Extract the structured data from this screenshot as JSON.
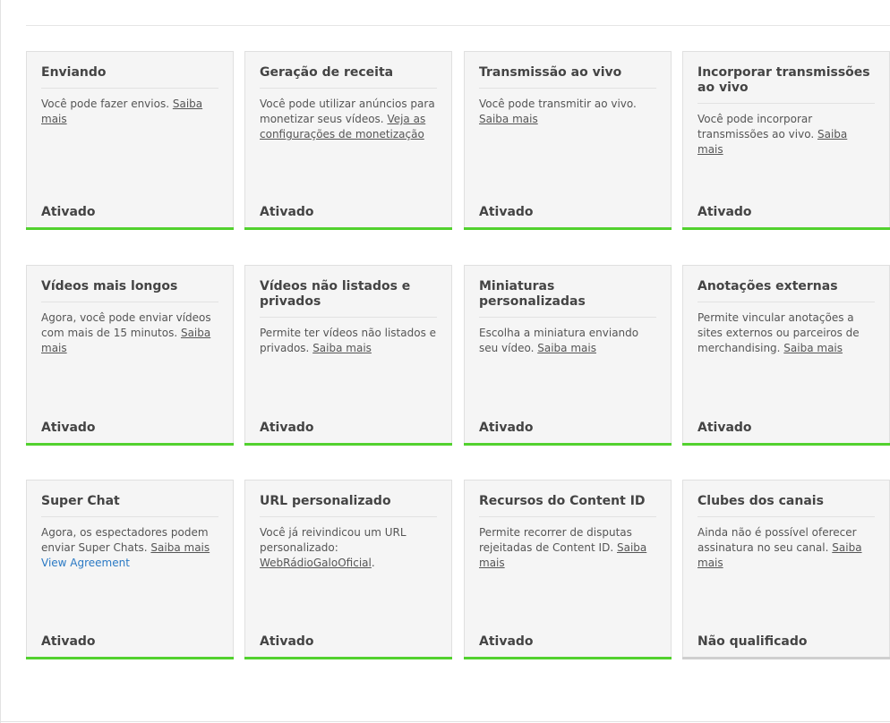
{
  "colors": {
    "active_bar": "#52d12e",
    "inactive_bar": "#cfcfcf",
    "link_blue": "#2a79c4"
  },
  "cards": [
    {
      "title": "Enviando",
      "desc": "Você pode fazer envios. ",
      "link": "Saiba mais",
      "status": "Ativado"
    },
    {
      "title": "Geração de receita",
      "desc": "Você pode utilizar anúncios para monetizar seus vídeos. ",
      "link": "Veja as configurações de monetização",
      "status": "Ativado"
    },
    {
      "title": "Transmissão ao vivo",
      "desc": "Você pode transmitir ao vivo. ",
      "link": "Saiba mais",
      "status": "Ativado"
    },
    {
      "title": "Incorporar transmissões ao vivo",
      "desc": "Você pode incorporar transmissões ao vivo. ",
      "link": "Saiba mais",
      "status": "Ativado"
    },
    {
      "title": "Vídeos mais longos",
      "desc": "Agora, você pode enviar vídeos com mais de 15 minutos. ",
      "link": "Saiba mais",
      "status": "Ativado"
    },
    {
      "title": "Vídeos não listados e privados",
      "desc": "Permite ter vídeos não listados e privados. ",
      "link": "Saiba mais",
      "status": "Ativado"
    },
    {
      "title": "Miniaturas personalizadas",
      "desc": "Escolha a miniatura enviando seu vídeo. ",
      "link": "Saiba mais",
      "status": "Ativado"
    },
    {
      "title": "Anotações externas",
      "desc": "Permite vincular anotações a sites externos ou parceiros de merchandising. ",
      "link": "Saiba mais",
      "status": "Ativado"
    },
    {
      "title": "Super Chat",
      "desc": "Agora, os espectadores podem enviar Super Chats. ",
      "link": "Saiba mais",
      "extra_link": "View Agreement",
      "status": "Ativado"
    },
    {
      "title": "URL personalizado",
      "desc": "Você já reivindicou um URL personalizado: ",
      "link": "WebRádioGaloOficial",
      "after": ".",
      "status": "Ativado"
    },
    {
      "title": "Recursos do Content ID",
      "desc": "Permite recorrer de disputas rejeitadas de Content ID. ",
      "link": "Saiba mais",
      "status": "Ativado"
    },
    {
      "title": "Clubes dos canais",
      "desc": "Ainda não é possível oferecer assinatura no seu canal. ",
      "link": "Saiba mais",
      "status": "Não qualificado",
      "inactive": true
    }
  ]
}
